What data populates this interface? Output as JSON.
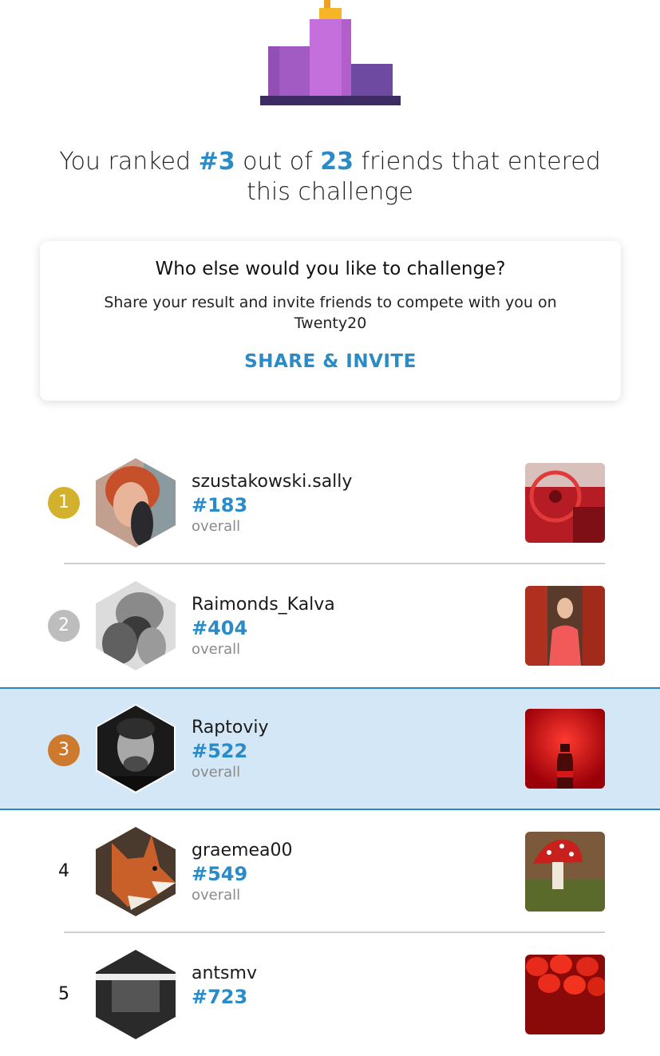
{
  "headline": {
    "prefix": "You ranked ",
    "rank": "#3",
    "middle": " out of ",
    "count": "23",
    "suffix": " friends that entered this challenge"
  },
  "card": {
    "title": "Who else would you like to challenge?",
    "text": "Share your result and invite friends to compete with you on Twenty20",
    "button": "SHARE & INVITE"
  },
  "colors": {
    "accent": "#2a8bc6",
    "gold": "#d4b12c",
    "silver": "#bdbdbd",
    "bronze": "#cd7a2e",
    "highlight": "#d3e7f6"
  },
  "leaderboard": [
    {
      "position": "1",
      "username": "szustakowski.sally",
      "rank": "#183",
      "overall": "overall"
    },
    {
      "position": "2",
      "username": "Raimonds_Kalva",
      "rank": "#404",
      "overall": "overall"
    },
    {
      "position": "3",
      "username": "Raptoviy",
      "rank": "#522",
      "overall": "overall"
    },
    {
      "position": "4",
      "username": "graemea00",
      "rank": "#549",
      "overall": "overall"
    },
    {
      "position": "5",
      "username": "antsmv",
      "rank": "#723",
      "overall": ""
    }
  ]
}
